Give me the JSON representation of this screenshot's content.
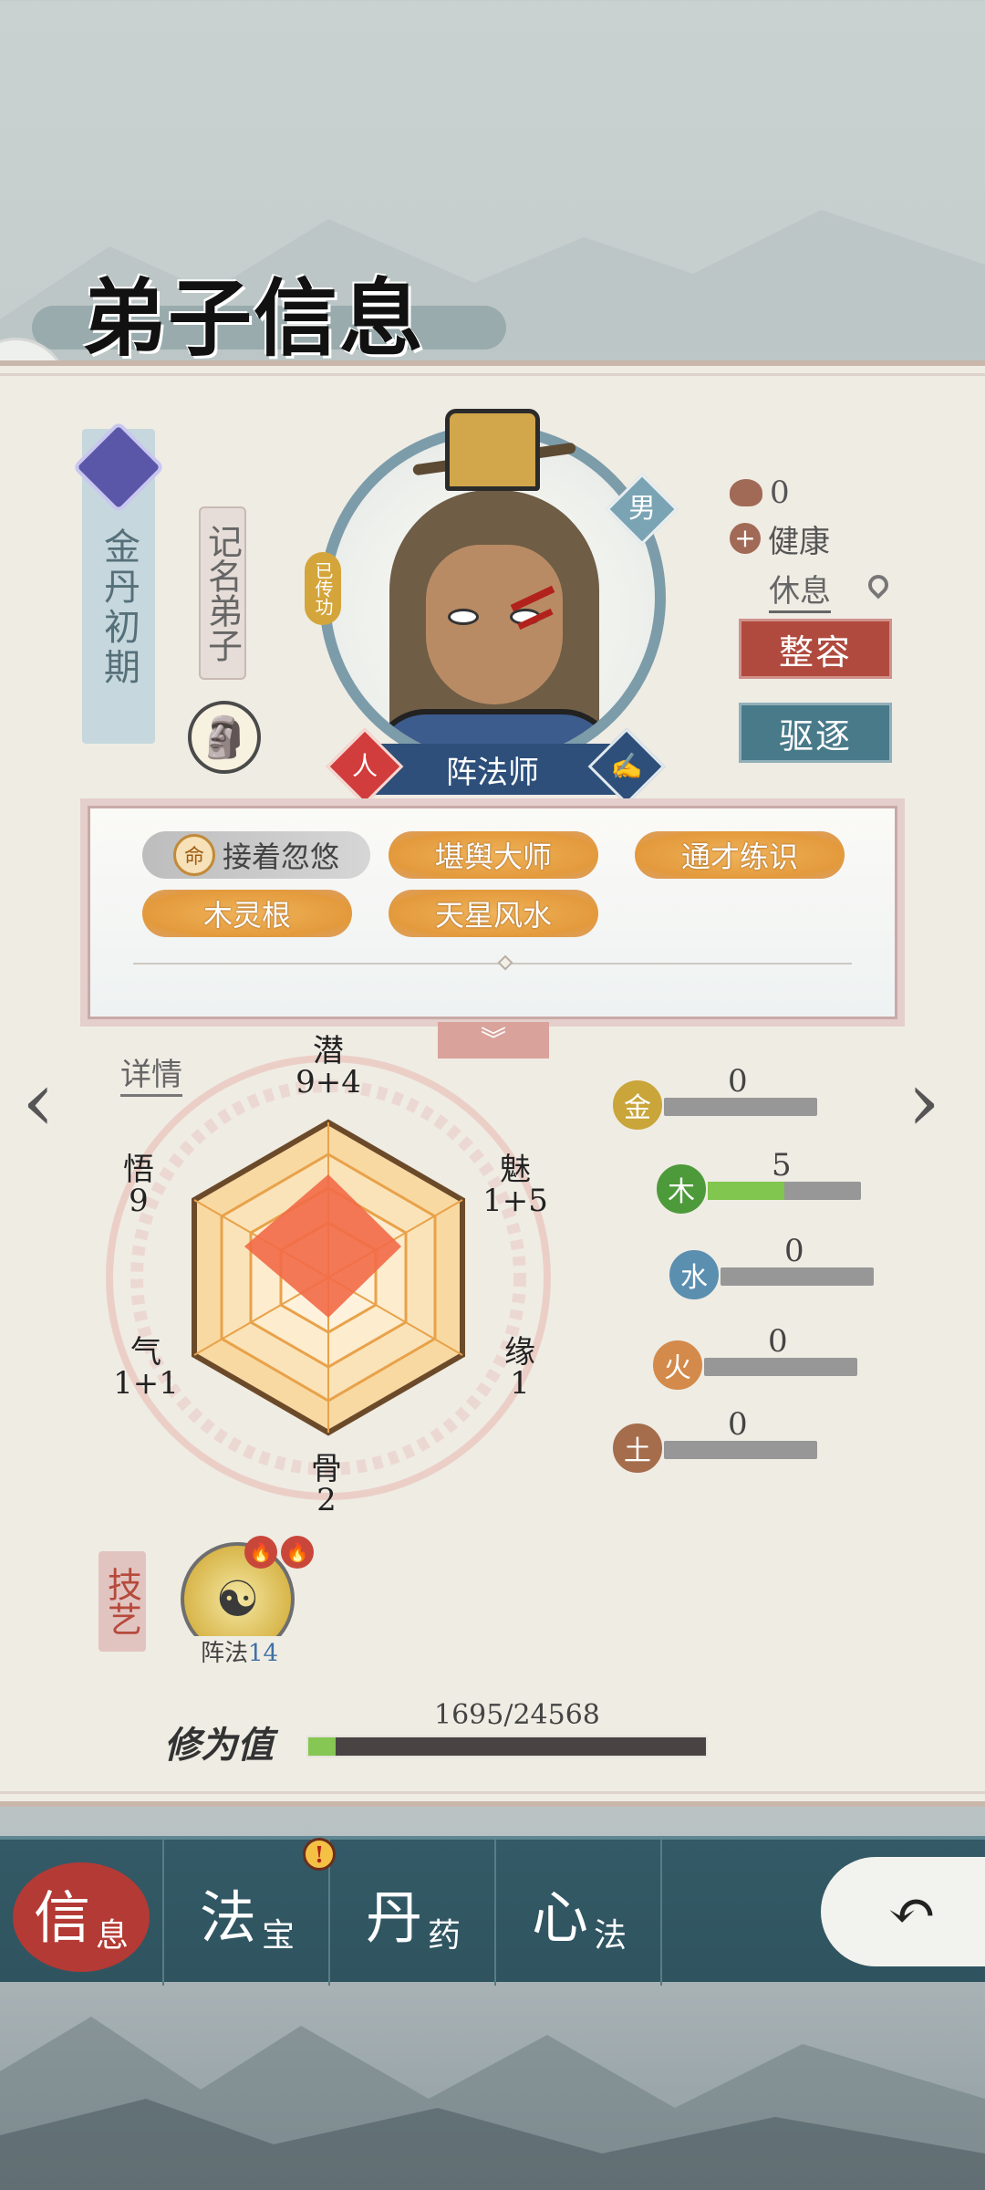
{
  "title": "弟子信息",
  "disciple": {
    "realm": "金丹初期",
    "rank": "记名弟子",
    "gender": "男",
    "passed_down": "已传功",
    "class_name": "阵法师",
    "class_left_badge": "人",
    "status_count": "0",
    "health": "健康",
    "activity": "休息"
  },
  "buttons": {
    "makeover": "整容",
    "expel": "驱逐",
    "details": "详情"
  },
  "traits": [
    {
      "label": "接着忽悠",
      "fate_icon": "命"
    },
    {
      "label": "堪舆大师"
    },
    {
      "label": "通才练识"
    },
    {
      "label": "木灵根"
    },
    {
      "label": "天星风水"
    }
  ],
  "attributes": {
    "potential": {
      "name": "潜",
      "value": "9+4"
    },
    "charm": {
      "name": "魅",
      "value": "1+5"
    },
    "fate": {
      "name": "缘",
      "value": "1"
    },
    "bone": {
      "name": "骨",
      "value": "2"
    },
    "qi": {
      "name": "气",
      "value": "1+1"
    },
    "insight": {
      "name": "悟",
      "value": "9"
    }
  },
  "elements": [
    {
      "name": "金",
      "value": "0",
      "level": 0,
      "color": "#c9a53a"
    },
    {
      "name": "木",
      "value": "5",
      "level": 0.5,
      "color": "#4d9a3a"
    },
    {
      "name": "水",
      "value": "0",
      "level": 0,
      "color": "#5b8fb0"
    },
    {
      "name": "火",
      "value": "0",
      "level": 0,
      "color": "#d38a4a"
    },
    {
      "name": "土",
      "value": "0",
      "level": 0,
      "color": "#a56d4c"
    }
  ],
  "skills_label": "技艺",
  "skill": {
    "name": "阵法",
    "level": "14"
  },
  "cultivation": {
    "label": "修为值",
    "value": "1695/24568",
    "current": 1695,
    "max": 24568
  },
  "nav": {
    "tabs": [
      {
        "big": "信",
        "small": "息"
      },
      {
        "big": "法",
        "small": "宝"
      },
      {
        "big": "丹",
        "small": "药"
      },
      {
        "big": "心",
        "small": "法"
      }
    ],
    "alert": "!"
  }
}
